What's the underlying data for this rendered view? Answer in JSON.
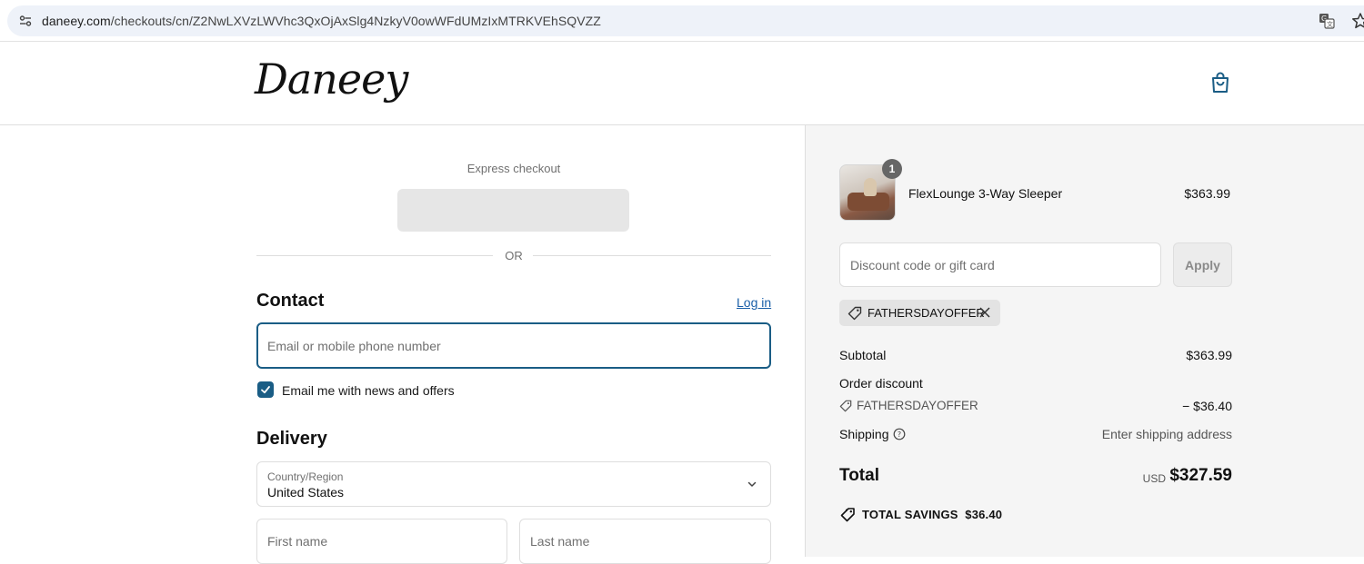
{
  "browser": {
    "url_host": "daneey.com",
    "url_path": "/checkouts/cn/Z2NwLXVzLWVhc3QxOjAxSlg4NzkyV0owWFdUMzIxMTRKVEhSQVZZ"
  },
  "header": {
    "logo_text": "Daneey",
    "cart_icon": "shopping-bag-icon"
  },
  "express": {
    "label": "Express checkout",
    "or_text": "OR"
  },
  "contact": {
    "title": "Contact",
    "login_link": "Log in",
    "email_placeholder": "Email or mobile phone number",
    "email_value": "",
    "news_checkbox_checked": true,
    "news_label": "Email me with news and offers"
  },
  "delivery": {
    "title": "Delivery",
    "country_label": "Country/Region",
    "country_value": "United States",
    "first_name_placeholder": "First name",
    "last_name_placeholder": "Last name"
  },
  "summary": {
    "product": {
      "name": "FlexLounge 3-Way Sleeper",
      "price": "$363.99",
      "quantity": "1"
    },
    "discount_placeholder": "Discount code or gift card",
    "apply_label": "Apply",
    "applied_code": "FATHERSDAYOFFER",
    "subtotal_label": "Subtotal",
    "subtotal_value": "$363.99",
    "order_discount_label": "Order discount",
    "order_discount_code": "FATHERSDAYOFFER",
    "order_discount_value": "− $36.40",
    "shipping_label": "Shipping",
    "shipping_value": "Enter shipping address",
    "total_label": "Total",
    "total_currency": "USD",
    "total_value": "$327.59",
    "savings_text": "TOTAL SAVINGS  $36.40"
  },
  "colors": {
    "accent": "#1a5d85",
    "link": "#1a5fa8",
    "summary_bg": "#f5f5f5"
  }
}
